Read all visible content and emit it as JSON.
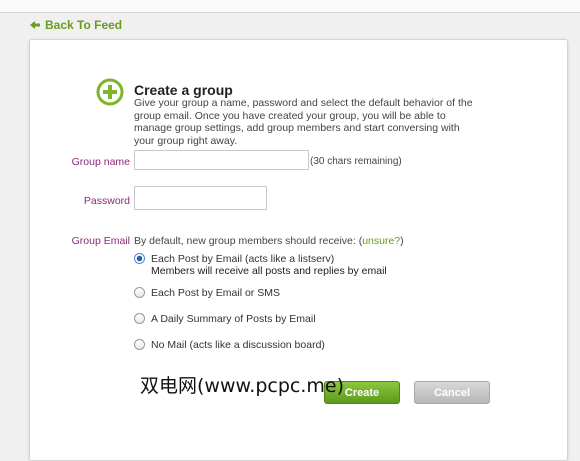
{
  "nav": {
    "back_label": "Back To Feed"
  },
  "form": {
    "title": "Create a group",
    "description": "Give your group a name, password and select the default behavior of the group email. Once you have created your group, you will be able to manage group settings, add group members and start conversing with your group right away.",
    "group_name_label": "Group name",
    "group_name_value": "",
    "group_name_remaining": "(30 chars remaining)",
    "password_label": "Password",
    "password_value": "",
    "group_email_label": "Group Email",
    "group_email_intro": "By default, new group members should receive: (",
    "unsure_link": "unsure?",
    "group_email_intro_close": ")",
    "options": [
      {
        "label": "Each Post by Email (acts like a listserv)",
        "sub": "Members will receive all posts and replies by email",
        "checked": true
      },
      {
        "label": "Each Post by Email or SMS",
        "checked": false
      },
      {
        "label": "A Daily Summary of Posts by Email",
        "checked": false
      },
      {
        "label": "No Mail (acts like a discussion board)",
        "checked": false
      }
    ],
    "create_label": "Create",
    "cancel_label": "Cancel"
  },
  "watermark": "双电网(www.pcpc.me)",
  "colors": {
    "accent_green": "#6a9a1f",
    "label_purple": "#8a2a7a",
    "create_button": "#5c9a1c",
    "cancel_button": "#b8b8b8"
  },
  "icons": {
    "back": "left-arrow-icon",
    "create_group": "plus-circle-icon"
  }
}
